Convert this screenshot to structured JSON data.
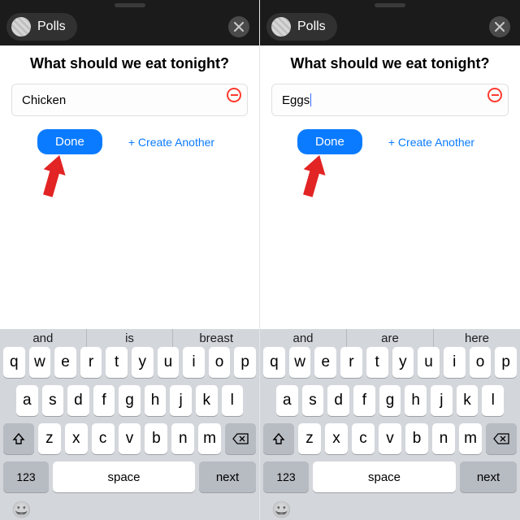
{
  "app": {
    "name": "Polls"
  },
  "poll": {
    "question": "What should we eat tonight?"
  },
  "actions": {
    "done": "Done",
    "create_another": "+ Create Another"
  },
  "left": {
    "input_value": "Chicken",
    "suggestions": [
      "and",
      "is",
      "breast"
    ]
  },
  "right": {
    "input_value": "Eggs",
    "suggestions": [
      "and",
      "are",
      "here"
    ]
  },
  "keyboard": {
    "row1": [
      "q",
      "w",
      "e",
      "r",
      "t",
      "y",
      "u",
      "i",
      "o",
      "p"
    ],
    "row2": [
      "a",
      "s",
      "d",
      "f",
      "g",
      "h",
      "j",
      "k",
      "l"
    ],
    "row3": [
      "z",
      "x",
      "c",
      "v",
      "b",
      "n",
      "m"
    ],
    "numbers": "123",
    "space": "space",
    "next": "next",
    "emoji": "😀"
  },
  "colors": {
    "accent": "#0a7bff",
    "danger": "#ff3b30"
  }
}
